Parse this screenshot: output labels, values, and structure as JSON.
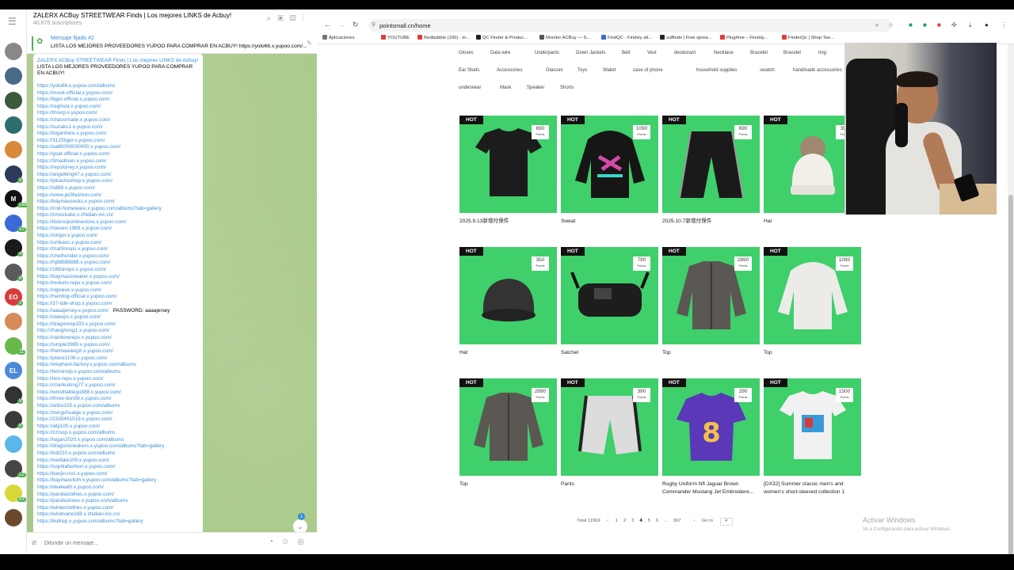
{
  "telegram": {
    "channel_title": "ZALERX ACBuy STREETWEAR Finds | Los mejores LINKS de Acbuy!",
    "subscribers": "40.876 suscriptores",
    "pinned_label": "Mensaje fijado #2",
    "pinned_text": "LISTA LOS MEJORES PROVEEDORES YUPOO PARA COMPRAR EN ACBUY! https://yolo66.x.yupoo.com/...",
    "message_title": "ZALERX ACBuy STREETWEAR Finds | Los mejores LINKS de Acbuy!",
    "message_intro": "LISTA LOS MEJORES PROVEEDORES YUPOO PARA COMPRAR EN ACBUY!",
    "links": [
      "https://yolo66.x.yupoo.com/albums",
      "https://mook-official.x.yupoo.com/",
      "https://tiger-official.x.yupoo.com/",
      "https://reghost.x.yupoo.com/",
      "https://threrp.x.yupoo.com/",
      "https://chaosmade.x.yupoo.com/",
      "https://suzaku1.x.yupoo.com/",
      "https://loganhere.x.yupoo.com/",
      "https://3125tiger.x.yupoo.com/",
      "https://aa80000000000.x.yupoo.com/",
      "https://goat-official.x.yupoo.com/",
      "https://3madmen.x.yupoo.com/",
      "https://repstoney.x.yupoo.com/",
      "https://angelking47.x.yupoo.com/",
      "https://pikachushop.x.yupoo.com/",
      "https://s888.x.yupoo.com/",
      "https://www.jet3fashion.com/",
      "https://baymaxsocks.x.yupoo.com/",
      "https://cnd-homeware.x.yupoo.com/albums?tab=gallery",
      "https://zmostudio.x.zhidian-inc.cn/",
      "https://listenuponlinestore.x.yupoo.com/",
      "https://steven-1989.x.yupoo.com/",
      "https://singor.x.yupoo.com/",
      "https://umkaxs.x.yupoo.com/",
      "https://martinreps.x.yupoo.com/",
      "https://chethunder.x.yupoo.com/",
      "https://hj88888888.x.yupoo.com/",
      "https://168shops.x.yupoo.com/",
      "https://baymaxsneaker.x.yupoo.com/",
      "https://reckets-reps.x.yupoo.com/",
      "https://ogwave.x.yupoo.com/",
      "https://heirdog-official.x.yupoo.com/",
      "https://37-tide-shop.x.yupoo.com/",
      "https://aaaajersey.x.yupoo.com/",
      "https://olareps.x.yupoo.com/",
      "https://dragonrep333.x.yupoo.com/",
      "http://zhanghong1.x.yupoo.com/",
      "https://rainbowreps.x.yupoo.com/",
      "https://simple3999.x.yupoo.com/",
      "https://heimawangzi.x.yupoo.com/",
      "https://plane1108.x.yupoo.com/",
      "https://elephant-factory.x.yupoo.com/albums",
      "https://lemonxip.x.yupoo.com/albums",
      "https://lion-reps.x.yupoo.com/",
      "https://charlesking77.x.yupoo.com/",
      "https://woodtablegu888.x.yupoo.com/",
      "https://three-don99.x.yupoo.com/",
      "https://anbo325.x.yupoo.com/albums",
      "https://zengshuaige.x.yupoo.com/",
      "https://2335491519.x.yupoo.com/",
      "https://ally100.x.yupoo.com/",
      "https://zzrsop.x.yupoo.com/albums",
      "https://logan2020.x.yupoo.com/albums",
      "https://dragonsneakers.x.yupoo.com/albums?tab=gallery",
      "https://kdi220.x.yupoo.com/albums",
      "https://wwfake100.x.yupoo.com/",
      "https://sophiafashion.x.yupoo.com/",
      "https://tianjin-no1.x.yupoo.com/",
      "https://baymaxcloth.x.yupoo.com/albums?tab=gallery",
      "https://deateath.x.yupoo.com/",
      "https://pandaclothes.x.yupoo.com/",
      "https://pandashoes.x.yupoo.com/albums",
      "https://winterclothes.x.yupoo.com/",
      "https://windvane168.x.zhidian-inc.cn/",
      "https://bullrep.x.yupoo.com/albums?tab=gallery"
    ],
    "password_text": "PASSWORD: aaaajersey",
    "scroll_badge": "1",
    "input_placeholder": "Difundir un mensaje..."
  },
  "rail": [
    {
      "color": "#888888",
      "text": "",
      "badge": ""
    },
    {
      "color": "#4a6a8a",
      "text": "",
      "badge": ""
    },
    {
      "color": "#3d5a3d",
      "text": "",
      "badge": ""
    },
    {
      "color": "#2c6e6e",
      "text": "",
      "badge": ""
    },
    {
      "color": "#d88a3a",
      "text": "",
      "badge": ""
    },
    {
      "color": "#2d3a5a",
      "text": "",
      "badge": "5"
    },
    {
      "color": "#111111",
      "text": "M",
      "badge": "169"
    },
    {
      "color": "#3a6ad8",
      "text": "",
      "badge": "10"
    },
    {
      "color": "#1a1a1a",
      "text": "",
      "badge": "4"
    },
    {
      "color": "#5a5a5a",
      "text": "",
      "badge": "6"
    },
    {
      "color": "#d83a3a",
      "text": "EO",
      "badge": "1"
    },
    {
      "color": "#d88a5a",
      "text": "",
      "badge": ""
    },
    {
      "color": "#6ab84a",
      "text": "",
      "badge": "11"
    },
    {
      "color": "#4a8ad8",
      "text": "EL",
      "badge": ""
    },
    {
      "color": "#333333",
      "text": "",
      "badge": "5"
    },
    {
      "color": "#3a3a3a",
      "text": "",
      "badge": "8"
    },
    {
      "color": "#5ab8e8",
      "text": "",
      "badge": ""
    },
    {
      "color": "#444444",
      "text": "",
      "badge": "12"
    },
    {
      "color": "#d8d83a",
      "text": "",
      "badge": "83"
    },
    {
      "color": "#6a4a2a",
      "text": "",
      "badge": ""
    }
  ],
  "browser": {
    "url": "pointsmall.cn/home",
    "bookmarks": [
      {
        "label": "Aplicaciones",
        "color": "#777777"
      },
      {
        "label": "YOUTUBE",
        "color": "#e53935"
      },
      {
        "label": "Redbubble (100) - m...",
        "color": "#e53935"
      },
      {
        "label": "QC Finder & Produc...",
        "color": "#222222"
      },
      {
        "label": "Monitor ACBuy — S...",
        "color": "#555555"
      },
      {
        "label": "FindQC - Findsly alt...",
        "color": "#3a6ad8"
      },
      {
        "label": "suffinds | Free sprea...",
        "color": "#222222"
      },
      {
        "label": "Plug4me – Findsly...",
        "color": "#e53935"
      },
      {
        "label": "FinderQc | Shop Tao...",
        "color": "#e53935"
      }
    ],
    "categories": [
      "Gloves",
      "Data wire",
      "Underpants",
      "Down Jackets",
      "Belt",
      "Vest",
      "deodorant",
      "Necklace",
      "Bracelet",
      "Bracelet",
      "ring",
      "Ear Studs",
      "Accessories",
      "Glasses",
      "Toys",
      "Wallet",
      "case of phone",
      "household supplies",
      "swatch",
      "handmade accessories",
      "b",
      "underwear",
      "Mask",
      "Speaker",
      "Shorts"
    ],
    "products": [
      {
        "name": "2025.9.13新增付保件",
        "points": "690",
        "shape": "tee-black"
      },
      {
        "name": "Sweat",
        "points": "1090",
        "shape": "hoodie-black"
      },
      {
        "name": "2025.10.7新增付保件",
        "points": "690",
        "shape": "pants-black"
      },
      {
        "name": "Hat",
        "points": "390",
        "shape": "beanie-white"
      },
      {
        "name": "Hat",
        "points": "350",
        "shape": "hat-black"
      },
      {
        "name": "Satchel",
        "points": "790",
        "shape": "bag-black"
      },
      {
        "name": "Top",
        "points": "2890",
        "shape": "jacket-grey"
      },
      {
        "name": "Top",
        "points": "1090",
        "shape": "hoodie-white"
      },
      {
        "name": "Top",
        "points": "2890",
        "shape": "jacket-grey"
      },
      {
        "name": "Pants",
        "points": "390",
        "shape": "shorts-white"
      },
      {
        "name": "Rugby Uniform Nfl Jaguar Brown Commander Mustang Jet Embroidere...",
        "points": "290",
        "shape": "jersey-purple"
      },
      {
        "name": "[DX32] Summer classic men's and women's short-sleeved collection 1",
        "points": "1500",
        "shape": "tee-white"
      }
    ],
    "hot_label": "HOT",
    "points_label": "Points",
    "pagination": {
      "total": "Total 11969",
      "prev": "‹",
      "pages": [
        "1",
        "2",
        "3",
        "4",
        "5",
        "6",
        "...",
        "997"
      ],
      "current": "4",
      "next": "›",
      "goto_label": "Go to",
      "goto_value": "4"
    },
    "watermark_title": "Activar Windows",
    "watermark_sub": "Ve a Configuración para activar Windows."
  }
}
